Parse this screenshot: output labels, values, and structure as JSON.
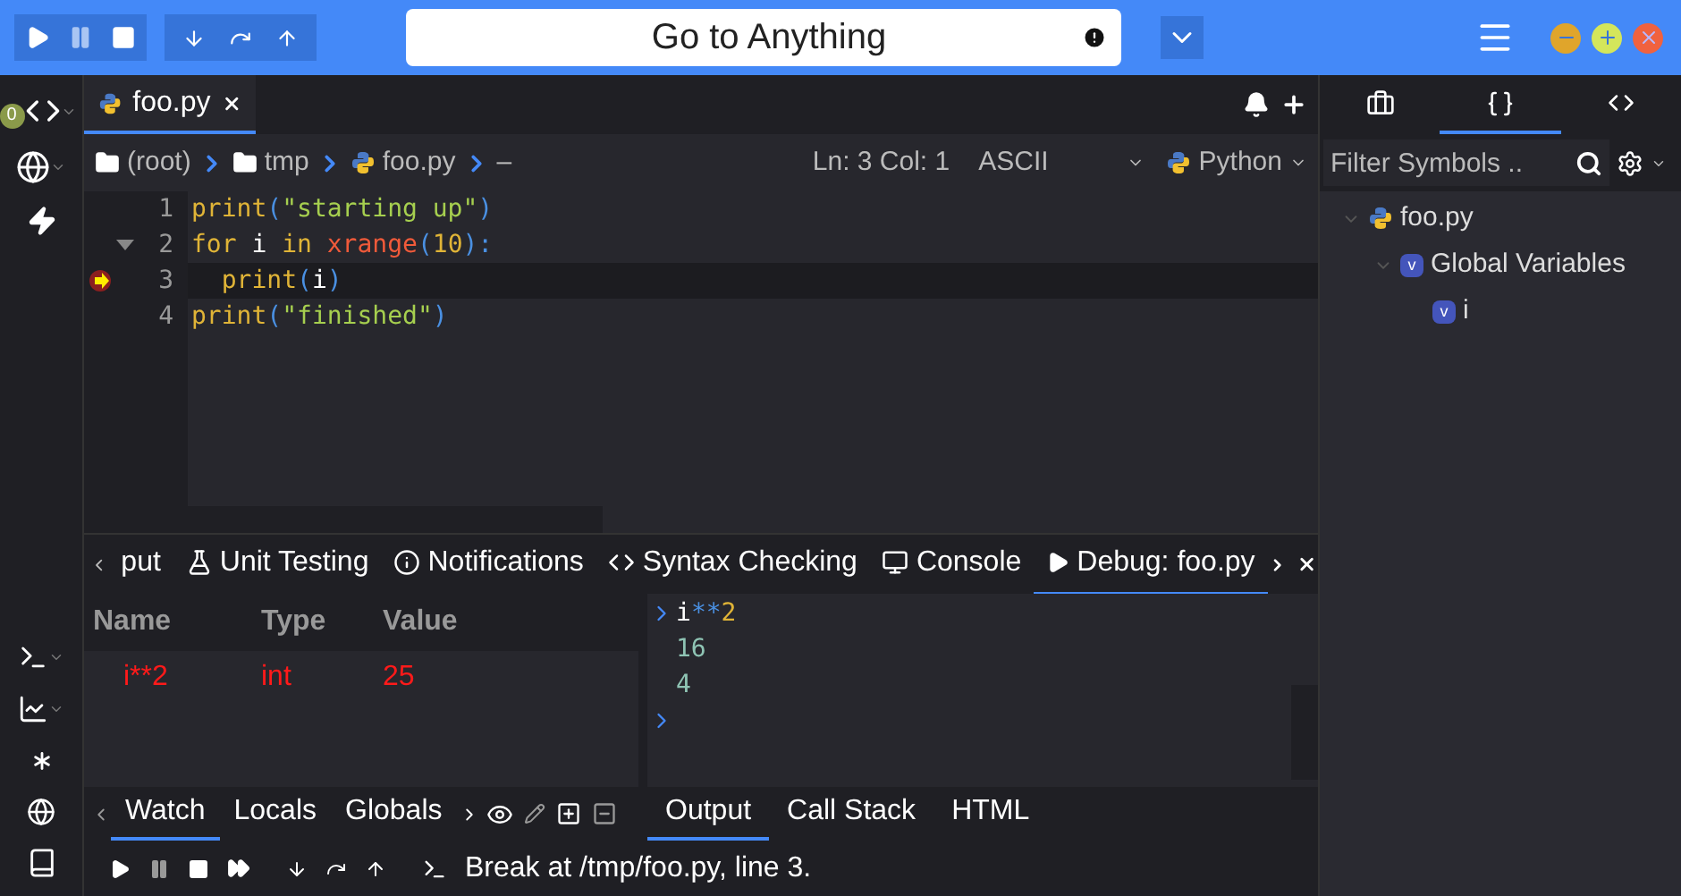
{
  "search": {
    "value": "Go to Anything"
  },
  "sidebar": {
    "badge": "0"
  },
  "editor_tabs": [
    {
      "label": "foo.py",
      "selected": true
    }
  ],
  "breadcrumb": [
    {
      "kind": "folder",
      "label": "(root)"
    },
    {
      "kind": "folder",
      "label": "tmp"
    },
    {
      "kind": "file",
      "label": "foo.py"
    },
    {
      "kind": "plain",
      "label": "–"
    }
  ],
  "status": {
    "position": "Ln: 3 Col: 1",
    "encoding": "ASCII",
    "language": "Python"
  },
  "code": [
    {
      "number": "1",
      "foldable": false,
      "current": false,
      "breakpoint": false,
      "tokens": [
        {
          "kind": "fn",
          "text": "print"
        },
        {
          "kind": "punct",
          "text": "("
        },
        {
          "kind": "str",
          "text": "\"starting up\""
        },
        {
          "kind": "punct",
          "text": ")"
        }
      ]
    },
    {
      "number": "2",
      "foldable": true,
      "current": false,
      "breakpoint": false,
      "tokens": [
        {
          "kind": "kw",
          "text": "for "
        },
        {
          "kind": "var",
          "text": "i"
        },
        {
          "kind": "kw",
          "text": " in "
        },
        {
          "kind": "builtin",
          "text": "xrange"
        },
        {
          "kind": "punct",
          "text": "("
        },
        {
          "kind": "num",
          "text": "10"
        },
        {
          "kind": "punct",
          "text": "):"
        }
      ]
    },
    {
      "number": "3",
      "foldable": false,
      "current": true,
      "breakpoint": true,
      "tokens": [
        {
          "kind": "fn",
          "text": "  print"
        },
        {
          "kind": "punct",
          "text": "("
        },
        {
          "kind": "var",
          "text": "i"
        },
        {
          "kind": "punct",
          "text": ")"
        }
      ]
    },
    {
      "number": "4",
      "foldable": false,
      "current": false,
      "breakpoint": false,
      "tokens": [
        {
          "kind": "fn",
          "text": "print"
        },
        {
          "kind": "punct",
          "text": "("
        },
        {
          "kind": "str",
          "text": "\"finished\""
        },
        {
          "kind": "punct",
          "text": ")"
        }
      ]
    }
  ],
  "bottom_tabs": [
    {
      "label": "put",
      "selected": false
    },
    {
      "label": "Unit Testing",
      "selected": false
    },
    {
      "label": "Notifications",
      "selected": false
    },
    {
      "label": "Syntax Checking",
      "selected": false
    },
    {
      "label": "Console",
      "selected": false
    },
    {
      "label": "Debug: foo.py",
      "selected": true
    }
  ],
  "watch": {
    "columns": [
      "Name",
      "Type",
      "Value"
    ],
    "rows": [
      {
        "cells": [
          "i**2",
          "int",
          "25"
        ],
        "changed": true
      }
    ]
  },
  "watch_tabs": [
    {
      "label": "Watch",
      "selected": true
    },
    {
      "label": "Locals",
      "selected": false
    },
    {
      "label": "Globals",
      "selected": false
    }
  ],
  "console": [
    {
      "kind": "input",
      "tokens": [
        {
          "kind": "var",
          "text": "i"
        },
        {
          "kind": "op",
          "text": "**"
        },
        {
          "kind": "num",
          "text": "2"
        }
      ]
    },
    {
      "kind": "output",
      "text": "16"
    },
    {
      "kind": "output",
      "text": "4"
    },
    {
      "kind": "prompt"
    }
  ],
  "output_tabs": [
    {
      "label": "Output",
      "selected": true
    },
    {
      "label": "Call Stack",
      "selected": false
    },
    {
      "label": "HTML",
      "selected": false
    }
  ],
  "debug_status": "Break at /tmp/foo.py, line 3.",
  "right_tabs": [
    {
      "selected": false
    },
    {
      "selected": true
    },
    {
      "selected": false
    }
  ],
  "symbols": {
    "placeholder": "Filter Symbols ..",
    "tree": [
      {
        "kind": "file",
        "label": "foo.py",
        "expanded": true,
        "children": [
          {
            "kind": "var",
            "badge": "v",
            "label": "Global Variables",
            "expanded": true,
            "children": [
              {
                "kind": "var",
                "badge": "v",
                "label": "i"
              }
            ]
          }
        ]
      }
    ]
  }
}
